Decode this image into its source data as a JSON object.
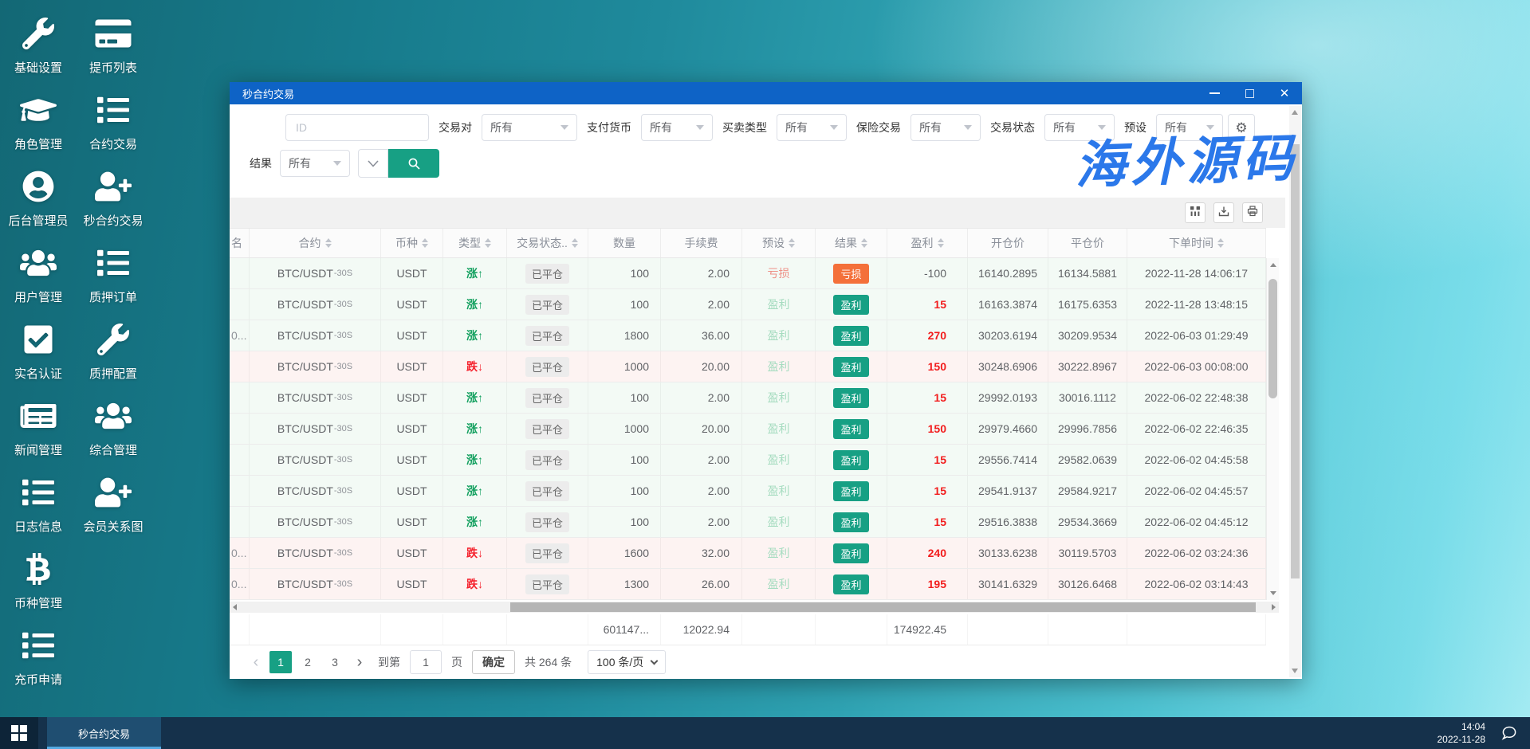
{
  "desktop": {
    "watermark": "海外源码",
    "icons": [
      {
        "label": "基础设置",
        "icon": "wrench-icon"
      },
      {
        "label": "提币列表",
        "icon": "card-icon"
      },
      {
        "label": "角色管理",
        "icon": "graduation-cap-icon"
      },
      {
        "label": "合约交易",
        "icon": "list-icon"
      },
      {
        "label": "后台管理员",
        "icon": "user-circle-icon"
      },
      {
        "label": "秒合约交易",
        "icon": "user-plus-icon"
      },
      {
        "label": "用户管理",
        "icon": "users-icon"
      },
      {
        "label": "质押订单",
        "icon": "list-icon"
      },
      {
        "label": "实名认证",
        "icon": "check-square-icon"
      },
      {
        "label": "质押配置",
        "icon": "wrench-icon"
      },
      {
        "label": "新闻管理",
        "icon": "newspaper-icon"
      },
      {
        "label": "综合管理",
        "icon": "users-icon"
      },
      {
        "label": "日志信息",
        "icon": "list-icon"
      },
      {
        "label": "会员关系图",
        "icon": "user-plus-icon"
      },
      {
        "label": "币种管理",
        "icon": "bitcoin-icon"
      },
      {
        "label": "充币申请",
        "icon": "list-icon"
      }
    ]
  },
  "window": {
    "title": "秒合约交易",
    "filters": {
      "id_placeholder": "ID",
      "selects": [
        {
          "label": "交易对",
          "value": "所有"
        },
        {
          "label": "支付货币",
          "value": "所有"
        },
        {
          "label": "买卖类型",
          "value": "所有"
        },
        {
          "label": "保险交易",
          "value": "所有"
        },
        {
          "label": "交易状态",
          "value": "所有"
        },
        {
          "label": "预设",
          "value": "所有"
        }
      ],
      "result_label": "结果",
      "result_value": "所有"
    },
    "toolbar": {
      "buttons": [
        {
          "icon": "columns-icon"
        },
        {
          "icon": "export-icon"
        },
        {
          "icon": "print-icon"
        }
      ]
    },
    "table": {
      "columns": [
        {
          "key": "user",
          "label": "名",
          "sortable": false
        },
        {
          "key": "contract",
          "label": "合约",
          "sortable": true
        },
        {
          "key": "currency",
          "label": "币种",
          "sortable": true
        },
        {
          "key": "type",
          "label": "类型",
          "sortable": true
        },
        {
          "key": "status",
          "label": "交易状态..",
          "sortable": true
        },
        {
          "key": "qty",
          "label": "数量",
          "sortable": false
        },
        {
          "key": "fee",
          "label": "手续费",
          "sortable": false
        },
        {
          "key": "preset",
          "label": "预设",
          "sortable": true
        },
        {
          "key": "result",
          "label": "结果",
          "sortable": true
        },
        {
          "key": "profit",
          "label": "盈利",
          "sortable": true
        },
        {
          "key": "open",
          "label": "开仓价",
          "sortable": false
        },
        {
          "key": "close",
          "label": "平仓价",
          "sortable": false
        },
        {
          "key": "time",
          "label": "下单时间",
          "sortable": true
        }
      ],
      "rows": [
        {
          "user": "",
          "pair": "BTC/USDT",
          "period": "-30S",
          "currency": "USDT",
          "type": "涨",
          "dir": "up",
          "status": "已平仓",
          "qty": "100",
          "fee": "2.00",
          "preset": "亏损",
          "preset_kind": "loss",
          "result": "亏损",
          "result_kind": "loss",
          "profit": "-100",
          "profit_red": false,
          "open": "16140.2895",
          "close": "16134.5881",
          "time": "2022-11-28 14:06:17"
        },
        {
          "user": "",
          "pair": "BTC/USDT",
          "period": "-30S",
          "currency": "USDT",
          "type": "涨",
          "dir": "up",
          "status": "已平仓",
          "qty": "100",
          "fee": "2.00",
          "preset": "盈利",
          "preset_kind": "win",
          "result": "盈利",
          "result_kind": "win",
          "profit": "15",
          "profit_red": true,
          "open": "16163.3874",
          "close": "16175.6353",
          "time": "2022-11-28 13:48:15"
        },
        {
          "user": "0...",
          "pair": "BTC/USDT",
          "period": "-30S",
          "currency": "USDT",
          "type": "涨",
          "dir": "up",
          "status": "已平仓",
          "qty": "1800",
          "fee": "36.00",
          "preset": "盈利",
          "preset_kind": "win",
          "result": "盈利",
          "result_kind": "win",
          "profit": "270",
          "profit_red": true,
          "open": "30203.6194",
          "close": "30209.9534",
          "time": "2022-06-03 01:29:49"
        },
        {
          "user": "",
          "pair": "BTC/USDT",
          "period": "-30S",
          "currency": "USDT",
          "type": "跌",
          "dir": "down",
          "status": "已平仓",
          "qty": "1000",
          "fee": "20.00",
          "preset": "盈利",
          "preset_kind": "win",
          "result": "盈利",
          "result_kind": "win",
          "profit": "150",
          "profit_red": true,
          "open": "30248.6906",
          "close": "30222.8967",
          "time": "2022-06-03 00:08:00"
        },
        {
          "user": "",
          "pair": "BTC/USDT",
          "period": "-30S",
          "currency": "USDT",
          "type": "涨",
          "dir": "up",
          "status": "已平仓",
          "qty": "100",
          "fee": "2.00",
          "preset": "盈利",
          "preset_kind": "win",
          "result": "盈利",
          "result_kind": "win",
          "profit": "15",
          "profit_red": true,
          "open": "29992.0193",
          "close": "30016.1112",
          "time": "2022-06-02 22:48:38"
        },
        {
          "user": "",
          "pair": "BTC/USDT",
          "period": "-30S",
          "currency": "USDT",
          "type": "涨",
          "dir": "up",
          "status": "已平仓",
          "qty": "1000",
          "fee": "20.00",
          "preset": "盈利",
          "preset_kind": "win",
          "result": "盈利",
          "result_kind": "win",
          "profit": "150",
          "profit_red": true,
          "open": "29979.4660",
          "close": "29996.7856",
          "time": "2022-06-02 22:46:35"
        },
        {
          "user": "",
          "pair": "BTC/USDT",
          "period": "-30S",
          "currency": "USDT",
          "type": "涨",
          "dir": "up",
          "status": "已平仓",
          "qty": "100",
          "fee": "2.00",
          "preset": "盈利",
          "preset_kind": "win",
          "result": "盈利",
          "result_kind": "win",
          "profit": "15",
          "profit_red": true,
          "open": "29556.7414",
          "close": "29582.0639",
          "time": "2022-06-02 04:45:58"
        },
        {
          "user": "",
          "pair": "BTC/USDT",
          "period": "-30S",
          "currency": "USDT",
          "type": "涨",
          "dir": "up",
          "status": "已平仓",
          "qty": "100",
          "fee": "2.00",
          "preset": "盈利",
          "preset_kind": "win",
          "result": "盈利",
          "result_kind": "win",
          "profit": "15",
          "profit_red": true,
          "open": "29541.9137",
          "close": "29584.9217",
          "time": "2022-06-02 04:45:57"
        },
        {
          "user": "",
          "pair": "BTC/USDT",
          "period": "-30S",
          "currency": "USDT",
          "type": "涨",
          "dir": "up",
          "status": "已平仓",
          "qty": "100",
          "fee": "2.00",
          "preset": "盈利",
          "preset_kind": "win",
          "result": "盈利",
          "result_kind": "win",
          "profit": "15",
          "profit_red": true,
          "open": "29516.3838",
          "close": "29534.3669",
          "time": "2022-06-02 04:45:12"
        },
        {
          "user": "0...",
          "pair": "BTC/USDT",
          "period": "-30S",
          "currency": "USDT",
          "type": "跌",
          "dir": "down",
          "status": "已平仓",
          "qty": "1600",
          "fee": "32.00",
          "preset": "盈利",
          "preset_kind": "win",
          "result": "盈利",
          "result_kind": "win",
          "profit": "240",
          "profit_red": true,
          "open": "30133.6238",
          "close": "30119.5703",
          "time": "2022-06-02 03:24:36"
        },
        {
          "user": "0...",
          "pair": "BTC/USDT",
          "period": "-30S",
          "currency": "USDT",
          "type": "跌",
          "dir": "down",
          "status": "已平仓",
          "qty": "1300",
          "fee": "26.00",
          "preset": "盈利",
          "preset_kind": "win",
          "result": "盈利",
          "result_kind": "win",
          "profit": "195",
          "profit_red": true,
          "open": "30141.6329",
          "close": "30126.6468",
          "time": "2022-06-02 03:14:43"
        }
      ]
    },
    "summary": {
      "qty": "601147...",
      "fee": "12022.94",
      "profit": "174922.45"
    },
    "pagination": {
      "prev": "‹",
      "pages": [
        {
          "label": "1",
          "active": true
        },
        {
          "label": "2",
          "active": false
        },
        {
          "label": "3",
          "active": false
        }
      ],
      "next": "›",
      "goto_label": "到第",
      "goto_value": "1",
      "page_unit": "页",
      "confirm_label": "确定",
      "total_label": "共 264 条",
      "per_page_label": "100 条/页"
    }
  },
  "taskbar": {
    "app": "秒合约交易",
    "time": "14:04",
    "date": "2022-11-28"
  },
  "colors": {
    "title_blue": "#0e63c6",
    "accent_teal": "#17a084",
    "loss_orange": "#f4703a",
    "profit_red": "#f21d1d",
    "watermark_blue": "#2b78ea"
  }
}
